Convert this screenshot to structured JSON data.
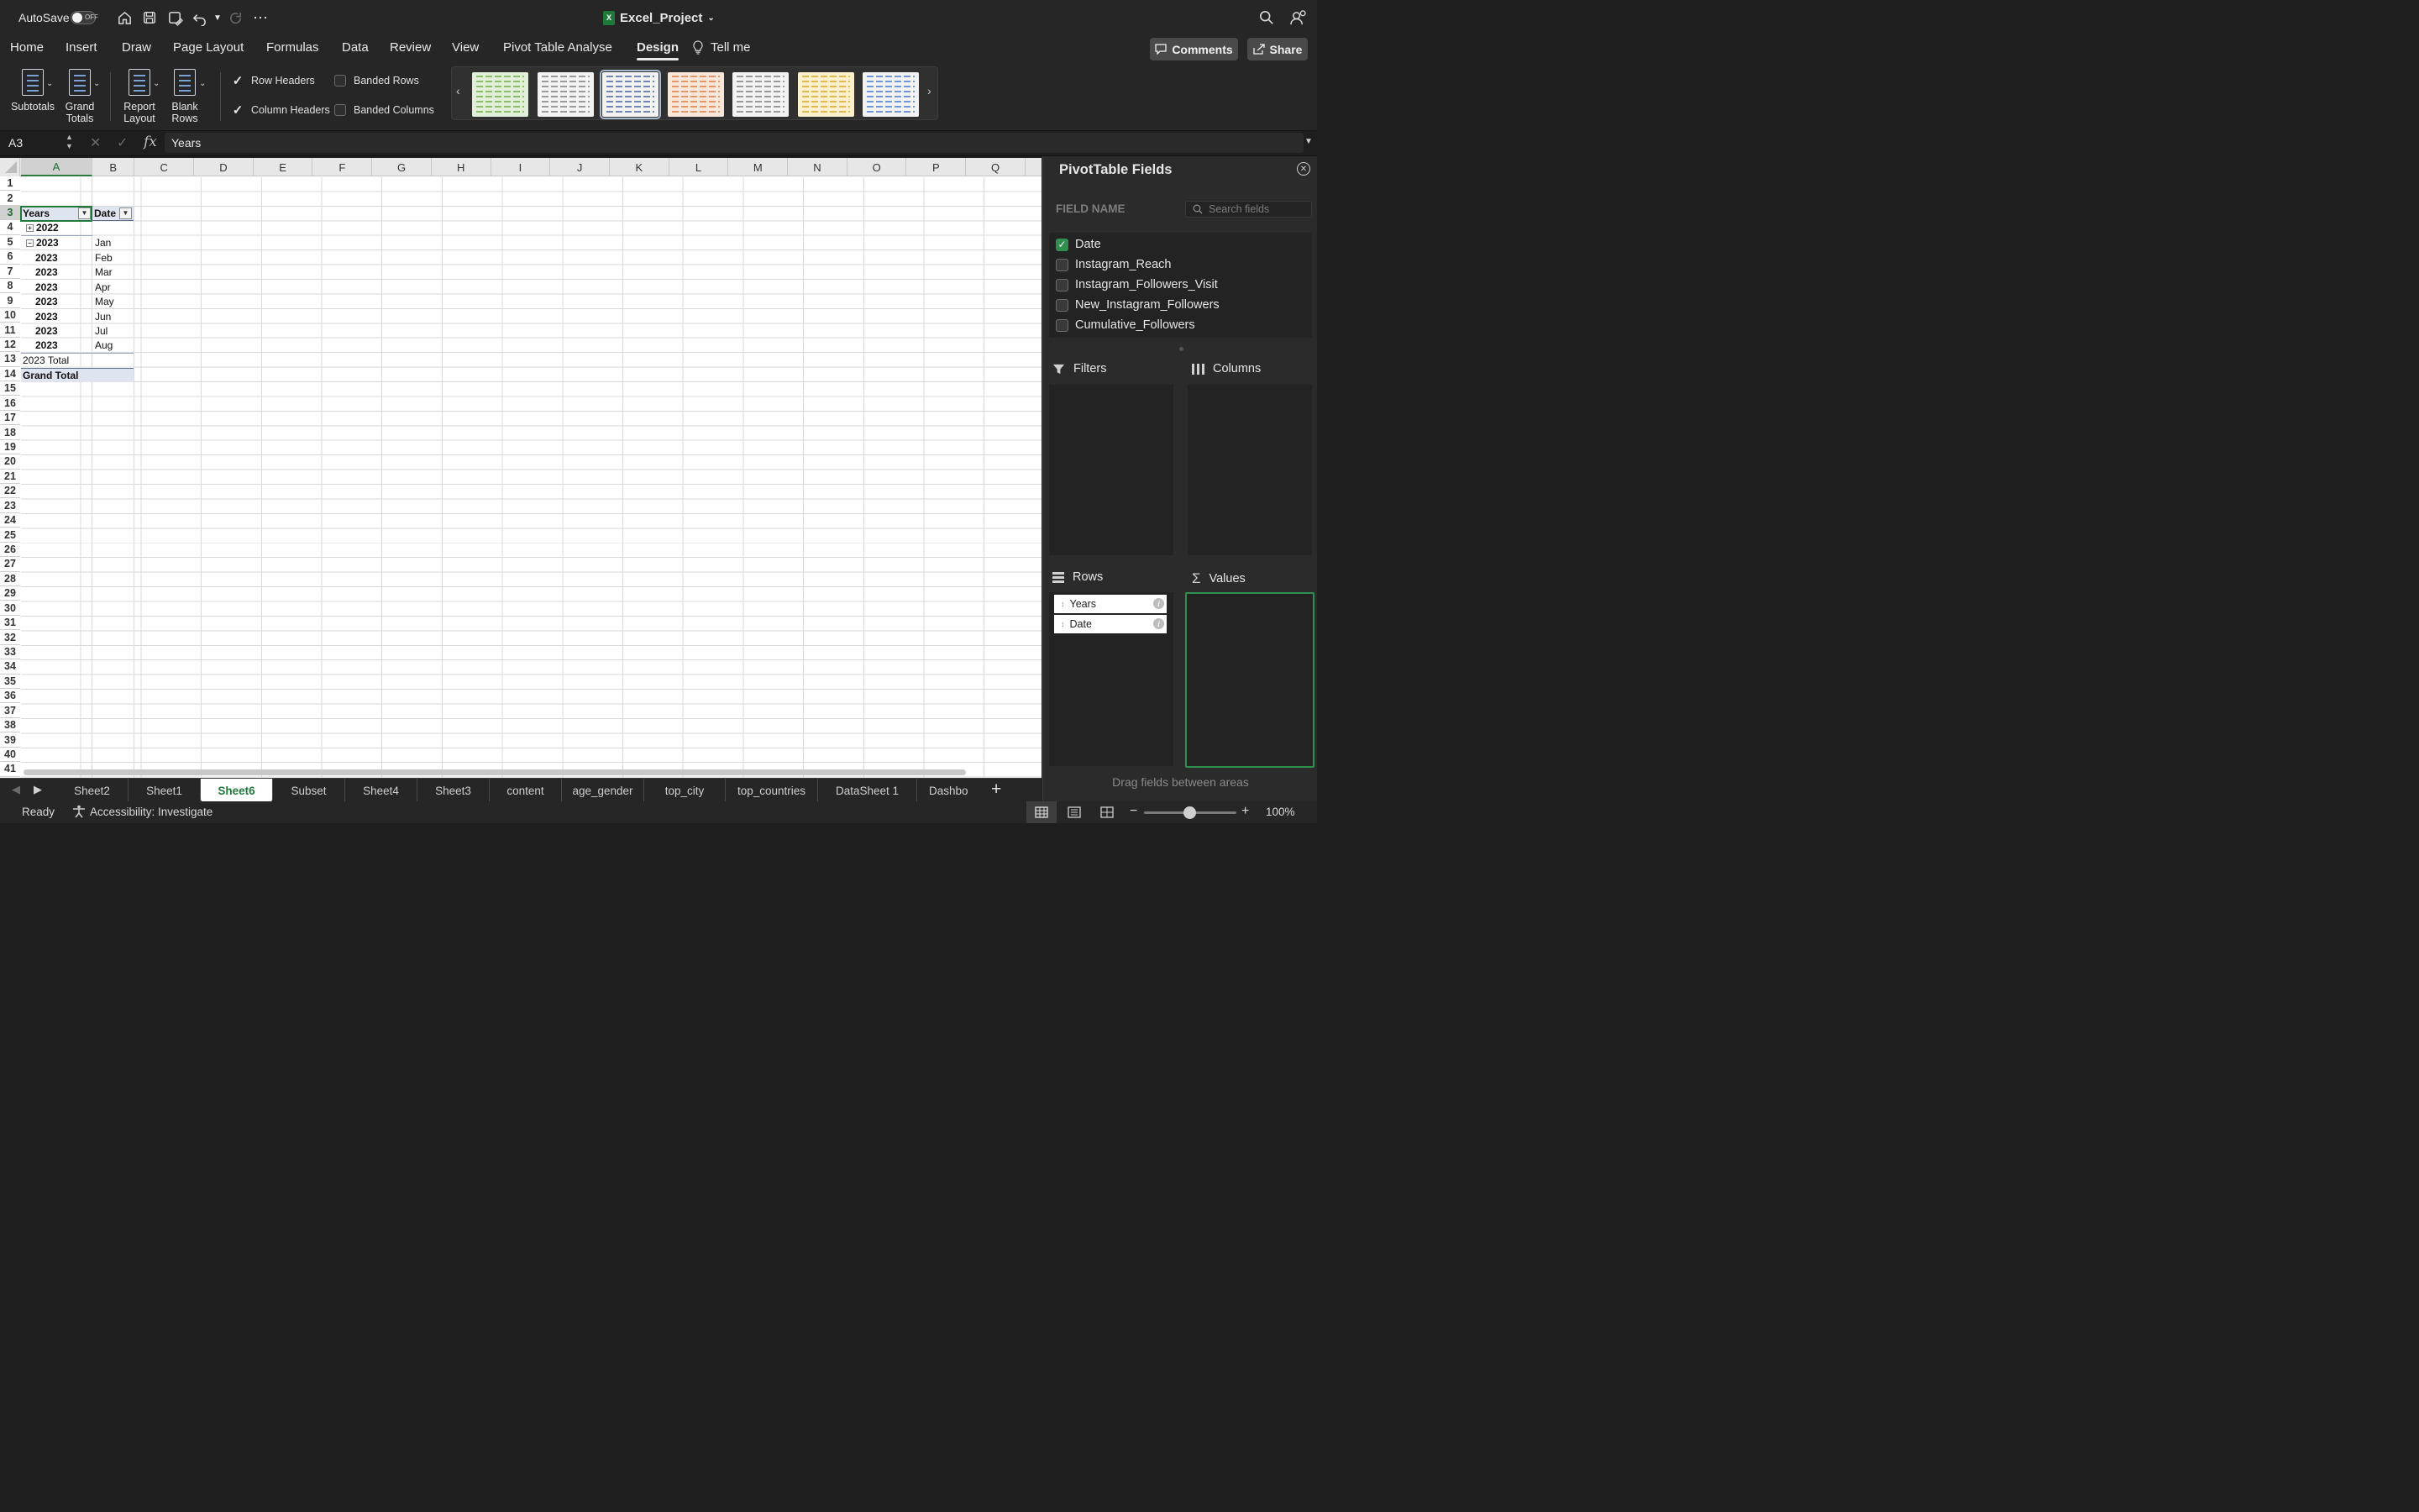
{
  "titlebar": {
    "autosave_label": "AutoSave",
    "autosave_state": "OFF",
    "doc_title": "Excel_Project"
  },
  "ribbon_tabs": [
    "Home",
    "Insert",
    "Draw",
    "Page Layout",
    "Formulas",
    "Data",
    "Review",
    "View",
    "Pivot Table Analyse",
    "Design"
  ],
  "active_tab": "Design",
  "tell_me": "Tell me",
  "comments_label": "Comments",
  "share_label": "Share",
  "design_ribbon": {
    "subtotals": "Subtotals",
    "grand_totals_1": "Grand",
    "grand_totals_2": "Totals",
    "report_layout_1": "Report",
    "report_layout_2": "Layout",
    "blank_rows_1": "Blank",
    "blank_rows_2": "Rows",
    "row_headers": "Row Headers",
    "column_headers": "Column Headers",
    "banded_rows": "Banded Rows",
    "banded_columns": "Banded Columns",
    "row_headers_checked": true,
    "column_headers_checked": true,
    "banded_rows_checked": false,
    "banded_columns_checked": false
  },
  "style_gallery": {
    "swatch_colors": [
      "#8dbb6a",
      "#9a9a9a",
      "#6f86b8",
      "#e3956c",
      "#9a9a9a",
      "#e3b84f",
      "#6f96d6"
    ],
    "selected_index": 2
  },
  "formula_bar": {
    "name_box": "A3",
    "fx": "fx",
    "formula": "Years"
  },
  "columns": [
    "A",
    "B",
    "C",
    "D",
    "E",
    "F",
    "G",
    "H",
    "I",
    "J",
    "K",
    "L",
    "M",
    "N",
    "O",
    "P",
    "Q"
  ],
  "rows": [
    "1",
    "2",
    "3",
    "4",
    "5",
    "6",
    "7",
    "8",
    "9",
    "10",
    "11",
    "12",
    "13",
    "14",
    "15",
    "16",
    "17",
    "18",
    "19",
    "20",
    "21",
    "22",
    "23",
    "24",
    "25",
    "26",
    "27",
    "28",
    "29",
    "30",
    "31",
    "32",
    "33",
    "34",
    "35",
    "36",
    "37",
    "38",
    "39",
    "40",
    "41"
  ],
  "pivot": {
    "header_years": "Years",
    "header_date": "Date",
    "row_2022": "2022",
    "row_2023": "2023",
    "months": [
      {
        "year": "2023",
        "month": "Jan"
      },
      {
        "year": "2023",
        "month": "Feb"
      },
      {
        "year": "2023",
        "month": "Mar"
      },
      {
        "year": "2023",
        "month": "Apr"
      },
      {
        "year": "2023",
        "month": "May"
      },
      {
        "year": "2023",
        "month": "Jun"
      },
      {
        "year": "2023",
        "month": "Jul"
      },
      {
        "year": "2023",
        "month": "Aug"
      }
    ],
    "subtotal": "2023 Total",
    "grand_total": "Grand Total"
  },
  "sheet_tabs": [
    "Sheet2",
    "Sheet1",
    "Sheet6",
    "Subset",
    "Sheet4",
    "Sheet3",
    "content",
    "age_gender",
    "top_city",
    "top_countries",
    "DataSheet 1",
    "Dashbo"
  ],
  "active_sheet": "Sheet6",
  "status": {
    "ready": "Ready",
    "accessibility": "Accessibility: Investigate",
    "zoom": "100%"
  },
  "pane": {
    "title": "PivotTable Fields",
    "field_name_label": "FIELD NAME",
    "search_placeholder": "Search fields",
    "fields": [
      {
        "name": "Date",
        "checked": true
      },
      {
        "name": "Instagram_Reach",
        "checked": false
      },
      {
        "name": "Instagram_Followers_Visit",
        "checked": false
      },
      {
        "name": "New_Instagram_Followers",
        "checked": false
      },
      {
        "name": "Cumulative_Followers",
        "checked": false
      }
    ],
    "filters_label": "Filters",
    "columns_label": "Columns",
    "rows_label": "Rows",
    "values_label": "Values",
    "rows_items": [
      "Years",
      "Date"
    ],
    "footer": "Drag fields between areas"
  }
}
